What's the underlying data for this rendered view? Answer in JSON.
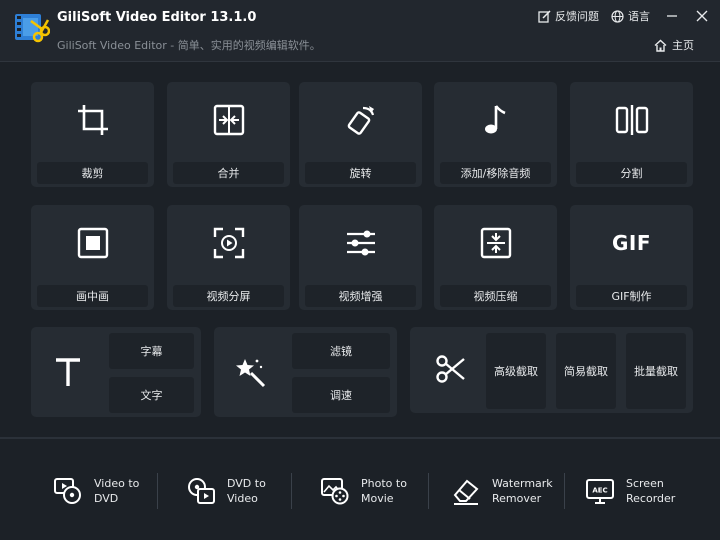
{
  "app": {
    "title": "GiliSoft Video Editor 13.1.0",
    "subtitle": "GiliSoft Video Editor - 简单、实用的视频编辑软件。"
  },
  "header": {
    "feedback_label": "反馈问题",
    "language_label": "语言",
    "home_label": "主页"
  },
  "tiles_row1": [
    {
      "label": "裁剪",
      "icon": "crop-icon"
    },
    {
      "label": "合并",
      "icon": "merge-icon"
    },
    {
      "label": "旋转",
      "icon": "rotate-icon"
    },
    {
      "label": "添加/移除音频",
      "icon": "music-note-icon"
    },
    {
      "label": "分割",
      "icon": "split-icon"
    }
  ],
  "tiles_row2": [
    {
      "label": "画中画",
      "icon": "picture-in-picture-icon"
    },
    {
      "label": "视频分屏",
      "icon": "split-screen-icon"
    },
    {
      "label": "视频增强",
      "icon": "sliders-icon"
    },
    {
      "label": "视频压缩",
      "icon": "compress-icon"
    },
    {
      "label": "GIF制作",
      "icon": "gif-icon",
      "icon_text": "GIF"
    }
  ],
  "groups": {
    "text": {
      "icon": "text-t-icon",
      "items": [
        "字幕",
        "文字"
      ]
    },
    "effects": {
      "icon": "magic-wand-icon",
      "items": [
        "滤镜",
        "调速"
      ]
    },
    "cut": {
      "icon": "scissors-icon",
      "items": [
        "高级截取",
        "简易截取",
        "批量截取"
      ]
    }
  },
  "tools": [
    {
      "label": "Video to\nDVD",
      "icon": "video-to-dvd-icon"
    },
    {
      "label": "DVD to\nVideo",
      "icon": "dvd-to-video-icon"
    },
    {
      "label": "Photo to\nMovie",
      "icon": "photo-to-movie-icon"
    },
    {
      "label": "Watermark\nRemover",
      "icon": "eraser-icon"
    },
    {
      "label": "Screen\nRecorder",
      "icon": "screen-recorder-icon",
      "icon_text": "AEC"
    }
  ],
  "colors": {
    "background": "#1c2127",
    "tile": "#262c33",
    "label_bar": "#1e2329",
    "accent_blue": "#2e7fd6",
    "accent_yellow": "#f5c400"
  }
}
